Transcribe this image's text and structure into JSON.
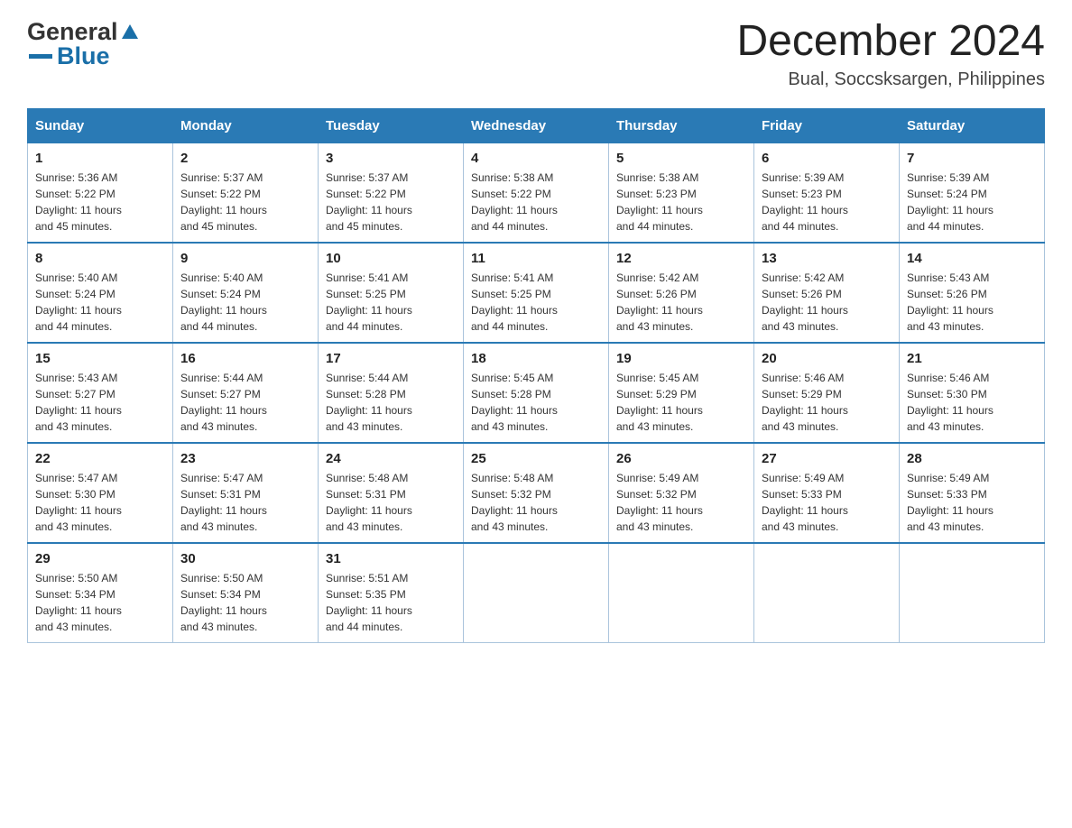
{
  "header": {
    "logo": {
      "general": "General",
      "blue": "Blue"
    },
    "title": "December 2024",
    "subtitle": "Bual, Soccsksargen, Philippines"
  },
  "days_of_week": [
    "Sunday",
    "Monday",
    "Tuesday",
    "Wednesday",
    "Thursday",
    "Friday",
    "Saturday"
  ],
  "weeks": [
    [
      {
        "day": "1",
        "sunrise": "5:36 AM",
        "sunset": "5:22 PM",
        "daylight": "11 hours and 45 minutes."
      },
      {
        "day": "2",
        "sunrise": "5:37 AM",
        "sunset": "5:22 PM",
        "daylight": "11 hours and 45 minutes."
      },
      {
        "day": "3",
        "sunrise": "5:37 AM",
        "sunset": "5:22 PM",
        "daylight": "11 hours and 45 minutes."
      },
      {
        "day": "4",
        "sunrise": "5:38 AM",
        "sunset": "5:22 PM",
        "daylight": "11 hours and 44 minutes."
      },
      {
        "day": "5",
        "sunrise": "5:38 AM",
        "sunset": "5:23 PM",
        "daylight": "11 hours and 44 minutes."
      },
      {
        "day": "6",
        "sunrise": "5:39 AM",
        "sunset": "5:23 PM",
        "daylight": "11 hours and 44 minutes."
      },
      {
        "day": "7",
        "sunrise": "5:39 AM",
        "sunset": "5:24 PM",
        "daylight": "11 hours and 44 minutes."
      }
    ],
    [
      {
        "day": "8",
        "sunrise": "5:40 AM",
        "sunset": "5:24 PM",
        "daylight": "11 hours and 44 minutes."
      },
      {
        "day": "9",
        "sunrise": "5:40 AM",
        "sunset": "5:24 PM",
        "daylight": "11 hours and 44 minutes."
      },
      {
        "day": "10",
        "sunrise": "5:41 AM",
        "sunset": "5:25 PM",
        "daylight": "11 hours and 44 minutes."
      },
      {
        "day": "11",
        "sunrise": "5:41 AM",
        "sunset": "5:25 PM",
        "daylight": "11 hours and 44 minutes."
      },
      {
        "day": "12",
        "sunrise": "5:42 AM",
        "sunset": "5:26 PM",
        "daylight": "11 hours and 43 minutes."
      },
      {
        "day": "13",
        "sunrise": "5:42 AM",
        "sunset": "5:26 PM",
        "daylight": "11 hours and 43 minutes."
      },
      {
        "day": "14",
        "sunrise": "5:43 AM",
        "sunset": "5:26 PM",
        "daylight": "11 hours and 43 minutes."
      }
    ],
    [
      {
        "day": "15",
        "sunrise": "5:43 AM",
        "sunset": "5:27 PM",
        "daylight": "11 hours and 43 minutes."
      },
      {
        "day": "16",
        "sunrise": "5:44 AM",
        "sunset": "5:27 PM",
        "daylight": "11 hours and 43 minutes."
      },
      {
        "day": "17",
        "sunrise": "5:44 AM",
        "sunset": "5:28 PM",
        "daylight": "11 hours and 43 minutes."
      },
      {
        "day": "18",
        "sunrise": "5:45 AM",
        "sunset": "5:28 PM",
        "daylight": "11 hours and 43 minutes."
      },
      {
        "day": "19",
        "sunrise": "5:45 AM",
        "sunset": "5:29 PM",
        "daylight": "11 hours and 43 minutes."
      },
      {
        "day": "20",
        "sunrise": "5:46 AM",
        "sunset": "5:29 PM",
        "daylight": "11 hours and 43 minutes."
      },
      {
        "day": "21",
        "sunrise": "5:46 AM",
        "sunset": "5:30 PM",
        "daylight": "11 hours and 43 minutes."
      }
    ],
    [
      {
        "day": "22",
        "sunrise": "5:47 AM",
        "sunset": "5:30 PM",
        "daylight": "11 hours and 43 minutes."
      },
      {
        "day": "23",
        "sunrise": "5:47 AM",
        "sunset": "5:31 PM",
        "daylight": "11 hours and 43 minutes."
      },
      {
        "day": "24",
        "sunrise": "5:48 AM",
        "sunset": "5:31 PM",
        "daylight": "11 hours and 43 minutes."
      },
      {
        "day": "25",
        "sunrise": "5:48 AM",
        "sunset": "5:32 PM",
        "daylight": "11 hours and 43 minutes."
      },
      {
        "day": "26",
        "sunrise": "5:49 AM",
        "sunset": "5:32 PM",
        "daylight": "11 hours and 43 minutes."
      },
      {
        "day": "27",
        "sunrise": "5:49 AM",
        "sunset": "5:33 PM",
        "daylight": "11 hours and 43 minutes."
      },
      {
        "day": "28",
        "sunrise": "5:49 AM",
        "sunset": "5:33 PM",
        "daylight": "11 hours and 43 minutes."
      }
    ],
    [
      {
        "day": "29",
        "sunrise": "5:50 AM",
        "sunset": "5:34 PM",
        "daylight": "11 hours and 43 minutes."
      },
      {
        "day": "30",
        "sunrise": "5:50 AM",
        "sunset": "5:34 PM",
        "daylight": "11 hours and 43 minutes."
      },
      {
        "day": "31",
        "sunrise": "5:51 AM",
        "sunset": "5:35 PM",
        "daylight": "11 hours and 44 minutes."
      },
      null,
      null,
      null,
      null
    ]
  ],
  "labels": {
    "sunrise": "Sunrise:",
    "sunset": "Sunset:",
    "daylight": "Daylight:"
  }
}
